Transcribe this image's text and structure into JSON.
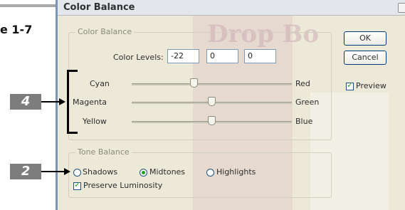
{
  "figure": {
    "label": "e 1-7"
  },
  "callouts": [
    {
      "number": "4"
    },
    {
      "number": "2"
    }
  ],
  "dialog": {
    "title": "Color Balance",
    "color_balance": {
      "group_title": "Color Balance",
      "levels_label": "Color Levels:",
      "levels": [
        "-22",
        "0",
        "0"
      ],
      "sliders": [
        {
          "left": "Cyan",
          "right": "Red",
          "value": -22
        },
        {
          "left": "Magenta",
          "right": "Green",
          "value": 0
        },
        {
          "left": "Yellow",
          "right": "Blue",
          "value": 0
        }
      ]
    },
    "tone_balance": {
      "group_title": "Tone Balance",
      "options": [
        "Shadows",
        "Midtones",
        "Highlights"
      ],
      "selected": "Midtones",
      "preserve_label": "Preserve Luminosity",
      "preserve_checked": true
    },
    "buttons": {
      "ok": "OK",
      "cancel": "Cancel"
    },
    "preview": {
      "label": "Preview",
      "checked": true
    }
  },
  "watermark": {
    "text": "Drop Bo"
  }
}
